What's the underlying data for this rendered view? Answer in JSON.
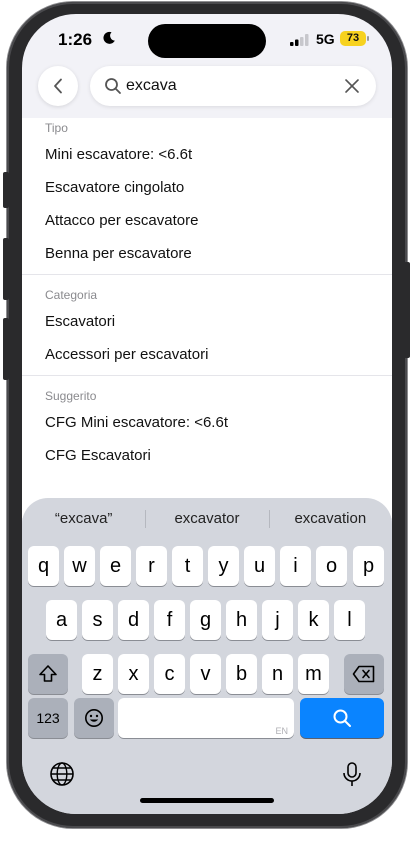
{
  "status_bar": {
    "time": "1:26",
    "network": "5G",
    "battery": "73"
  },
  "search": {
    "query": "excava",
    "placeholder": ""
  },
  "sections": [
    {
      "header": "Tipo",
      "items": [
        "Mini escavatore: <6.6t",
        "Escavatore cingolato",
        "Attacco per escavatore",
        "Benna per escavatore"
      ]
    },
    {
      "header": "Categoria",
      "items": [
        "Escavatori",
        "Accessori per escavatori"
      ]
    },
    {
      "header": "Suggerito",
      "items": [
        "CFG Mini escavatore: <6.6t",
        "CFG Escavatori"
      ]
    }
  ],
  "keyboard": {
    "predictions": [
      "“excava”",
      "excavator",
      "excavation"
    ],
    "row1": [
      "q",
      "w",
      "e",
      "r",
      "t",
      "y",
      "u",
      "i",
      "o",
      "p"
    ],
    "row2": [
      "a",
      "s",
      "d",
      "f",
      "g",
      "h",
      "j",
      "k",
      "l"
    ],
    "row3": [
      "z",
      "x",
      "c",
      "v",
      "b",
      "n",
      "m"
    ],
    "numbers_label": "123",
    "space_hint": "EN"
  },
  "colors": {
    "accent": "#0a84ff",
    "battery": "#f7d21f"
  }
}
